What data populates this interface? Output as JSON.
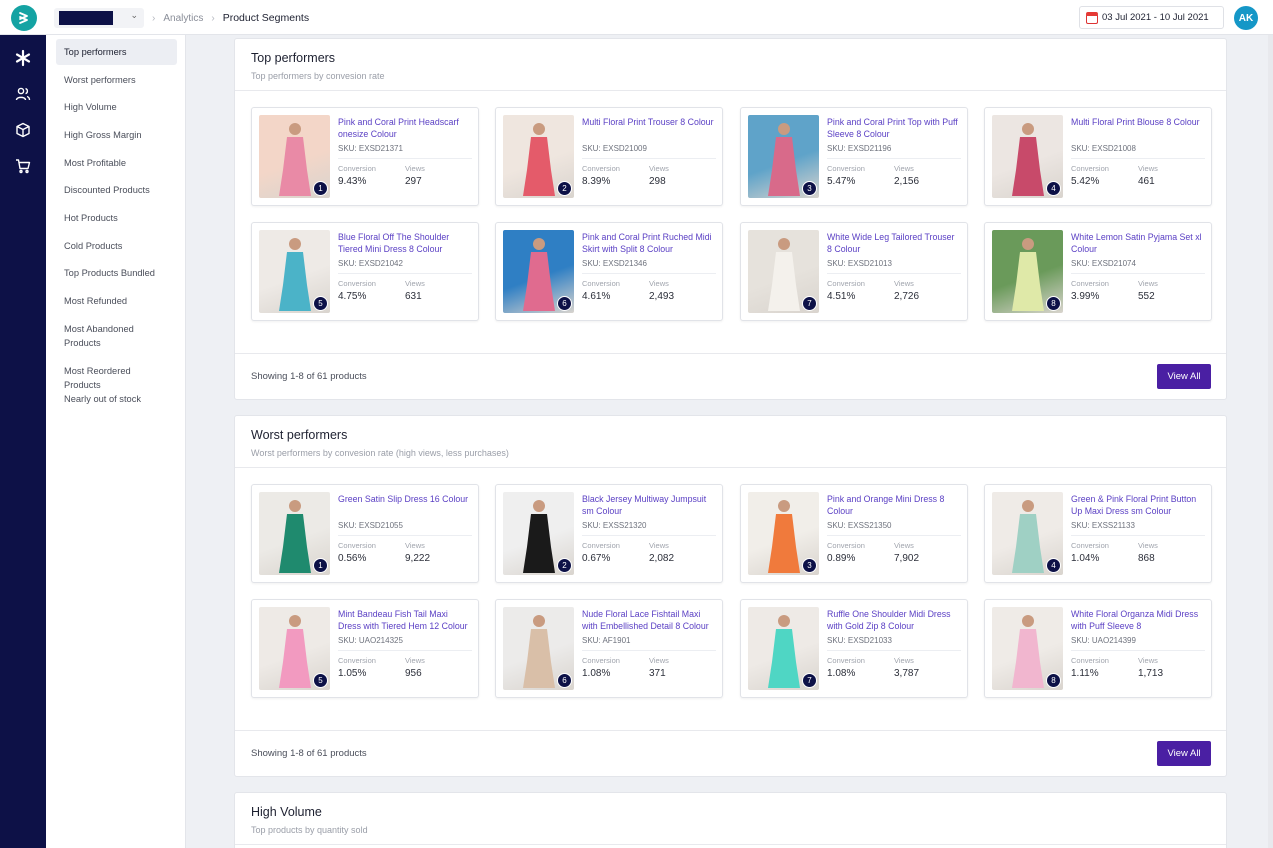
{
  "header": {
    "breadcrumb_root": "Analytics",
    "breadcrumb_current": "Product Segments",
    "date_range": "03 Jul 2021 - 10 Jul 2021",
    "user_initials": "AK"
  },
  "rail": {
    "icons": [
      "asterisk-icon",
      "users-icon",
      "box-icon",
      "cart-icon"
    ]
  },
  "segments": [
    "Top performers",
    "Worst performers",
    "High Volume",
    "High Gross Margin",
    "Most Profitable",
    "Discounted Products",
    "Hot Products",
    "Cold Products",
    "Top Products Bundled",
    "Most Refunded",
    "Most Abandoned Products",
    "Most Reordered Products",
    "Nearly out of stock"
  ],
  "labels": {
    "conversion": "Conversion",
    "views": "Views"
  },
  "colors": {
    "brand": "#0d1147",
    "accent": "#4a1fa3",
    "link": "#5a3fc4",
    "logo": "#14a3a3"
  },
  "panels": [
    {
      "title": "Top performers",
      "subtitle": "Top performers by convesion rate",
      "showing": "Showing 1-8 of 61 products",
      "button": "View All",
      "products": [
        {
          "rank": "1",
          "name": "Pink and Coral Print Headscarf onesize Colour",
          "sku": "SKU: EXSD21371",
          "conversion": "9.43%",
          "views": "297",
          "c1": "#e98aa6",
          "c2": "#f3d6c8"
        },
        {
          "rank": "2",
          "name": "Multi Floral Print Trouser 8 Colour",
          "sku": "SKU: EXSD21009",
          "conversion": "8.39%",
          "views": "298",
          "c1": "#e45b6a",
          "c2": "#efe6df"
        },
        {
          "rank": "3",
          "name": "Pink and Coral Print Top with Puff Sleeve 8 Colour",
          "sku": "SKU: EXSD21196",
          "conversion": "5.47%",
          "views": "2,156",
          "c1": "#d86a8a",
          "c2": "#5fa3c9"
        },
        {
          "rank": "4",
          "name": "Multi Floral Print Blouse 8 Colour",
          "sku": "SKU: EXSD21008",
          "conversion": "5.42%",
          "views": "461",
          "c1": "#c84a6a",
          "c2": "#ece6e2"
        },
        {
          "rank": "5",
          "name": "Blue Floral Off The Shoulder Tiered Mini Dress 8 Colour",
          "sku": "SKU: EXSD21042",
          "conversion": "4.75%",
          "views": "631",
          "c1": "#4bb3c8",
          "c2": "#eeeae6"
        },
        {
          "rank": "6",
          "name": "Pink and Coral Print Ruched Midi Skirt with Split 8 Colour",
          "sku": "SKU: EXSD21346",
          "conversion": "4.61%",
          "views": "2,493",
          "c1": "#e06b8f",
          "c2": "#2f7fc4"
        },
        {
          "rank": "7",
          "name": "White Wide Leg Tailored Trouser 8 Colour",
          "sku": "SKU: EXSD21013",
          "conversion": "4.51%",
          "views": "2,726",
          "c1": "#f4f1ec",
          "c2": "#e6e2dc"
        },
        {
          "rank": "8",
          "name": "White Lemon Satin Pyjama Set xl Colour",
          "sku": "SKU: EXSD21074",
          "conversion": "3.99%",
          "views": "552",
          "c1": "#dfe9a8",
          "c2": "#6a9a5a"
        }
      ]
    },
    {
      "title": "Worst performers",
      "subtitle": "Worst performers by convesion rate (high views, less purchases)",
      "showing": "Showing 1-8 of 61 products",
      "button": "View All",
      "products": [
        {
          "rank": "1",
          "name": "Green Satin Slip Dress 16 Colour",
          "sku": "SKU: EXSD21055",
          "conversion": "0.56%",
          "views": "9,222",
          "c1": "#1f8a6e",
          "c2": "#eceae6"
        },
        {
          "rank": "2",
          "name": "Black Jersey Multiway Jumpsuit sm Colour",
          "sku": "SKU: EXSS21320",
          "conversion": "0.67%",
          "views": "2,082",
          "c1": "#1a1a1a",
          "c2": "#efefef"
        },
        {
          "rank": "3",
          "name": "Pink and Orange Mini Dress 8 Colour",
          "sku": "SKU: EXSS21350",
          "conversion": "0.89%",
          "views": "7,902",
          "c1": "#f07a3c",
          "c2": "#f1eee9"
        },
        {
          "rank": "4",
          "name": "Green & Pink Floral Print Button Up Maxi Dress sm Colour",
          "sku": "SKU: EXSS21133",
          "conversion": "1.04%",
          "views": "868",
          "c1": "#9fd0c4",
          "c2": "#efebe7"
        },
        {
          "rank": "5",
          "name": "Mint Bandeau Fish Tail Maxi Dress with Tiered Hem 12 Colour",
          "sku": "SKU: UAO214325",
          "conversion": "1.05%",
          "views": "956",
          "c1": "#f29ac0",
          "c2": "#eeeae6"
        },
        {
          "rank": "6",
          "name": "Nude Floral Lace Fishtail Maxi with Embellished Detail 8 Colour",
          "sku": "SKU: AF1901",
          "conversion": "1.08%",
          "views": "371",
          "c1": "#d9bfa8",
          "c2": "#ecebea"
        },
        {
          "rank": "7",
          "name": "Ruffle One Shoulder Midi Dress with Gold Zip 8 Colour",
          "sku": "SKU: EXSD21033",
          "conversion": "1.08%",
          "views": "3,787",
          "c1": "#4fd6c4",
          "c2": "#eeeae6"
        },
        {
          "rank": "8",
          "name": "White Floral Organza Midi Dress with Puff Sleeve 8",
          "sku": "SKU: UAO214399",
          "conversion": "1.11%",
          "views": "1,713",
          "c1": "#f1b6cf",
          "c2": "#efebe7"
        }
      ]
    },
    {
      "title": "High Volume",
      "subtitle": "Top products by quantity sold"
    }
  ]
}
